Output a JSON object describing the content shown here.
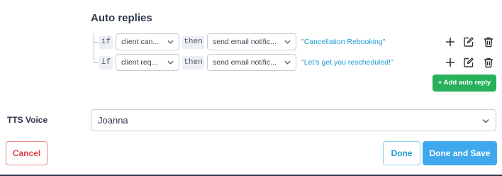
{
  "auto_replies": {
    "title": "Auto replies",
    "rules": [
      {
        "if_label": "if",
        "condition": "client can...",
        "then_label": "then",
        "action": "send email notific...",
        "value": "\"Cancellation Rebooking\""
      },
      {
        "if_label": "if",
        "condition": "client req...",
        "then_label": "then",
        "action": "send email notific...",
        "value": "\"Let's get you rescheduled!\""
      }
    ],
    "add_button": "+ Add auto reply"
  },
  "tts": {
    "label": "TTS Voice",
    "value": "Joanna"
  },
  "footer": {
    "cancel": "Cancel",
    "done": "Done",
    "done_save": "Done and Save"
  },
  "colors": {
    "accent_blue": "#40a9ee",
    "link_blue": "#1f9bd1",
    "green": "#27b15a",
    "danger": "#e0434b"
  },
  "icons": {
    "add": "plus-icon",
    "edit": "edit-icon",
    "delete": "trash-icon",
    "dropdown": "chevron-down-icon"
  }
}
